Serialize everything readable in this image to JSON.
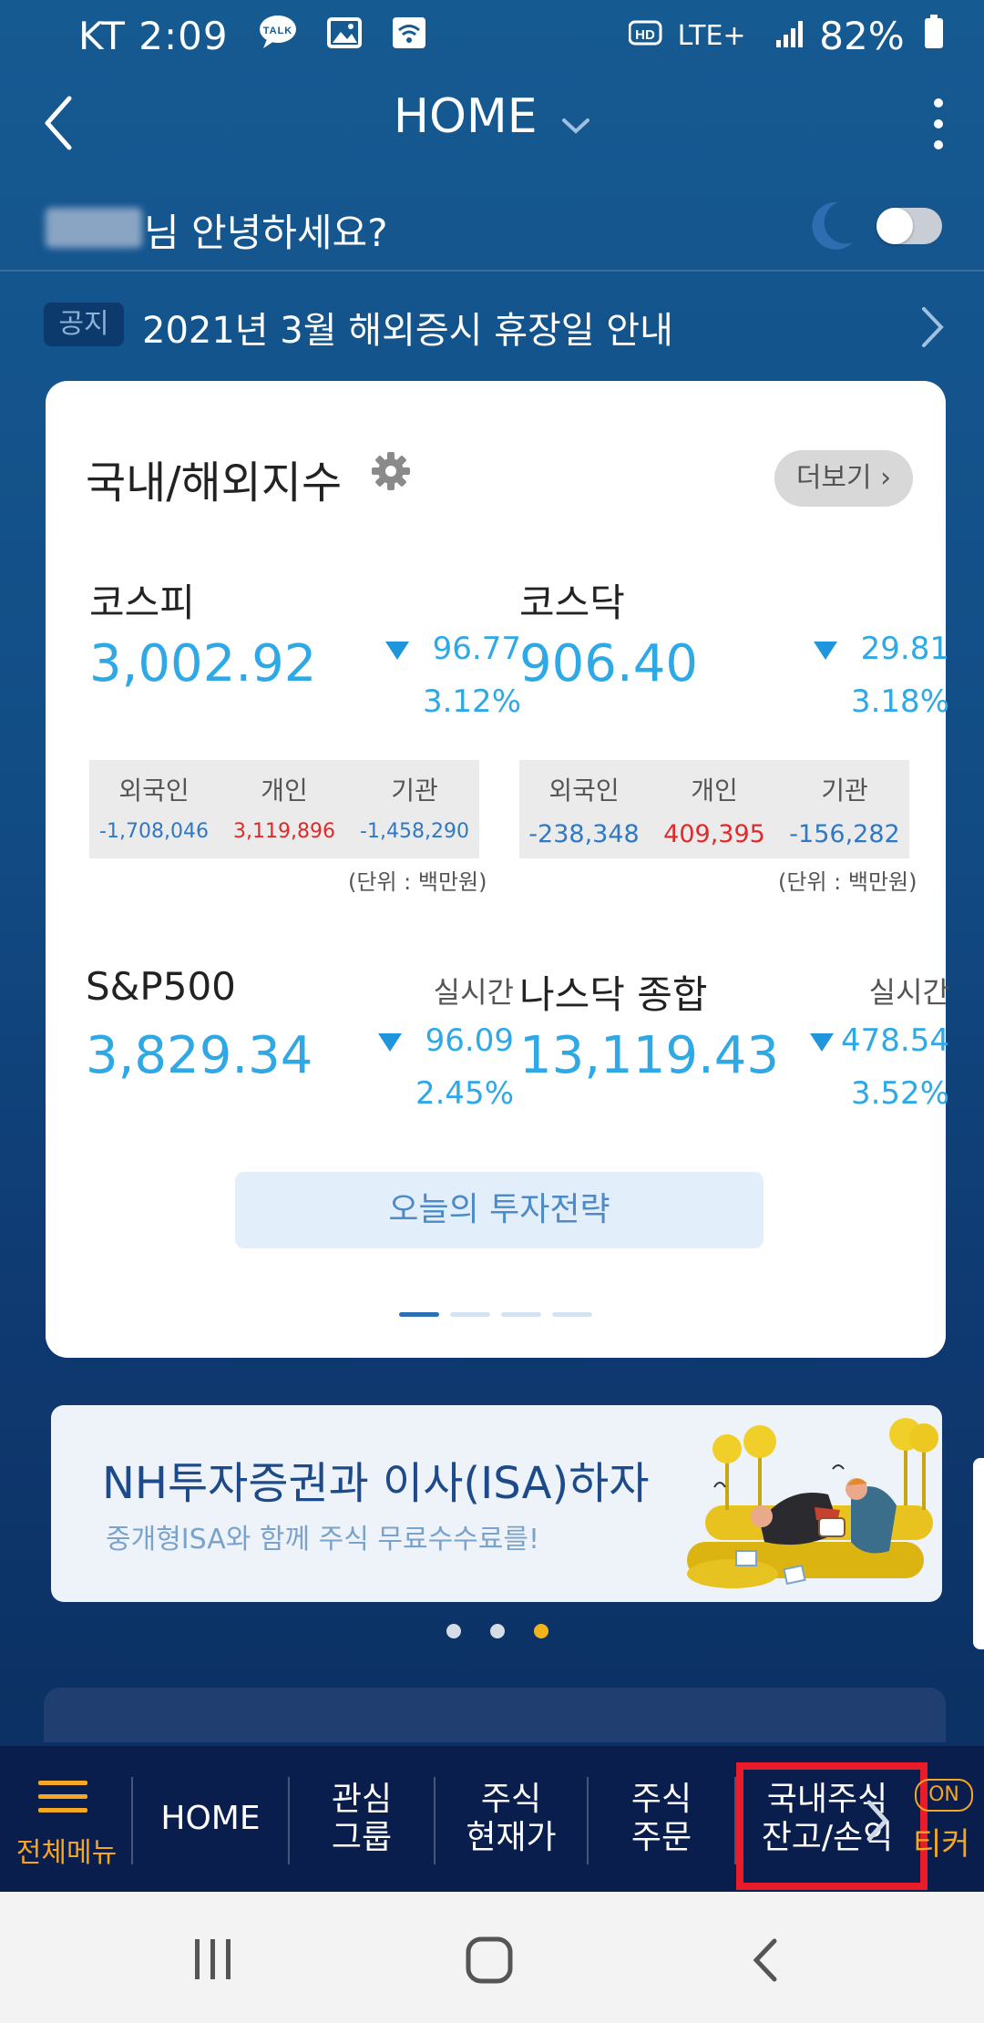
{
  "status_bar": {
    "carrier": "KT",
    "time": "2:09",
    "network": "LTE+",
    "battery": "82%"
  },
  "header": {
    "title": "HOME"
  },
  "greeting": {
    "text": "님 안녕하세요?"
  },
  "notice": {
    "badge": "공지",
    "text": "2021년 3월 해외증시 휴장일 안내"
  },
  "index_card": {
    "title": "국내/해외지수",
    "more_label": "더보기",
    "indices": [
      {
        "name": "코스피",
        "value": "3,002.92",
        "change": "96.77",
        "percent": "3.12%",
        "direction": "down"
      },
      {
        "name": "코스닥",
        "value": "906.40",
        "change": "29.81",
        "percent": "3.18%",
        "direction": "down"
      },
      {
        "name": "S&P500",
        "label_right": "실시간",
        "value": "3,829.34",
        "change": "96.09",
        "percent": "2.45%",
        "direction": "down"
      },
      {
        "name": "나스닥 종합",
        "label_right": "실시간",
        "value": "13,119.43",
        "change": "478.54",
        "percent": "3.52%",
        "direction": "down"
      }
    ],
    "investor_headers": [
      "외국인",
      "개인",
      "기관"
    ],
    "kospi_investors": [
      "-1,708,046",
      "3,119,896",
      "-1,458,290"
    ],
    "kosdaq_investors": [
      "-238,348",
      "409,395",
      "-156,282"
    ],
    "unit_label": "(단위 : 백만원)",
    "strategy_button": "오늘의 투자전략",
    "page_count": 4,
    "page_active": 1
  },
  "banner": {
    "headline": "NH투자증권과 이사(ISA)하자",
    "subline": "중개형ISA와 함께 주식 무료수수료를!",
    "dot_count": 3,
    "dot_active": 3
  },
  "bottom_nav": {
    "menu_label": "전체메뉴",
    "home": "HOME",
    "watch_1": "관심",
    "watch_2": "그룹",
    "price_1": "주식",
    "price_2": "현재가",
    "order_1": "주식",
    "order_2": "주문",
    "balance_1": "국내주식",
    "balance_2": "잔고/손익",
    "ticker_on": "ON",
    "ticker_label": "티커"
  },
  "colors": {
    "accent": "#2fa8e6",
    "down_blue": "#1f95dc",
    "up_red": "#e02a2a",
    "menu_orange": "#f5a623",
    "highlight_red": "#ea1c2a"
  }
}
